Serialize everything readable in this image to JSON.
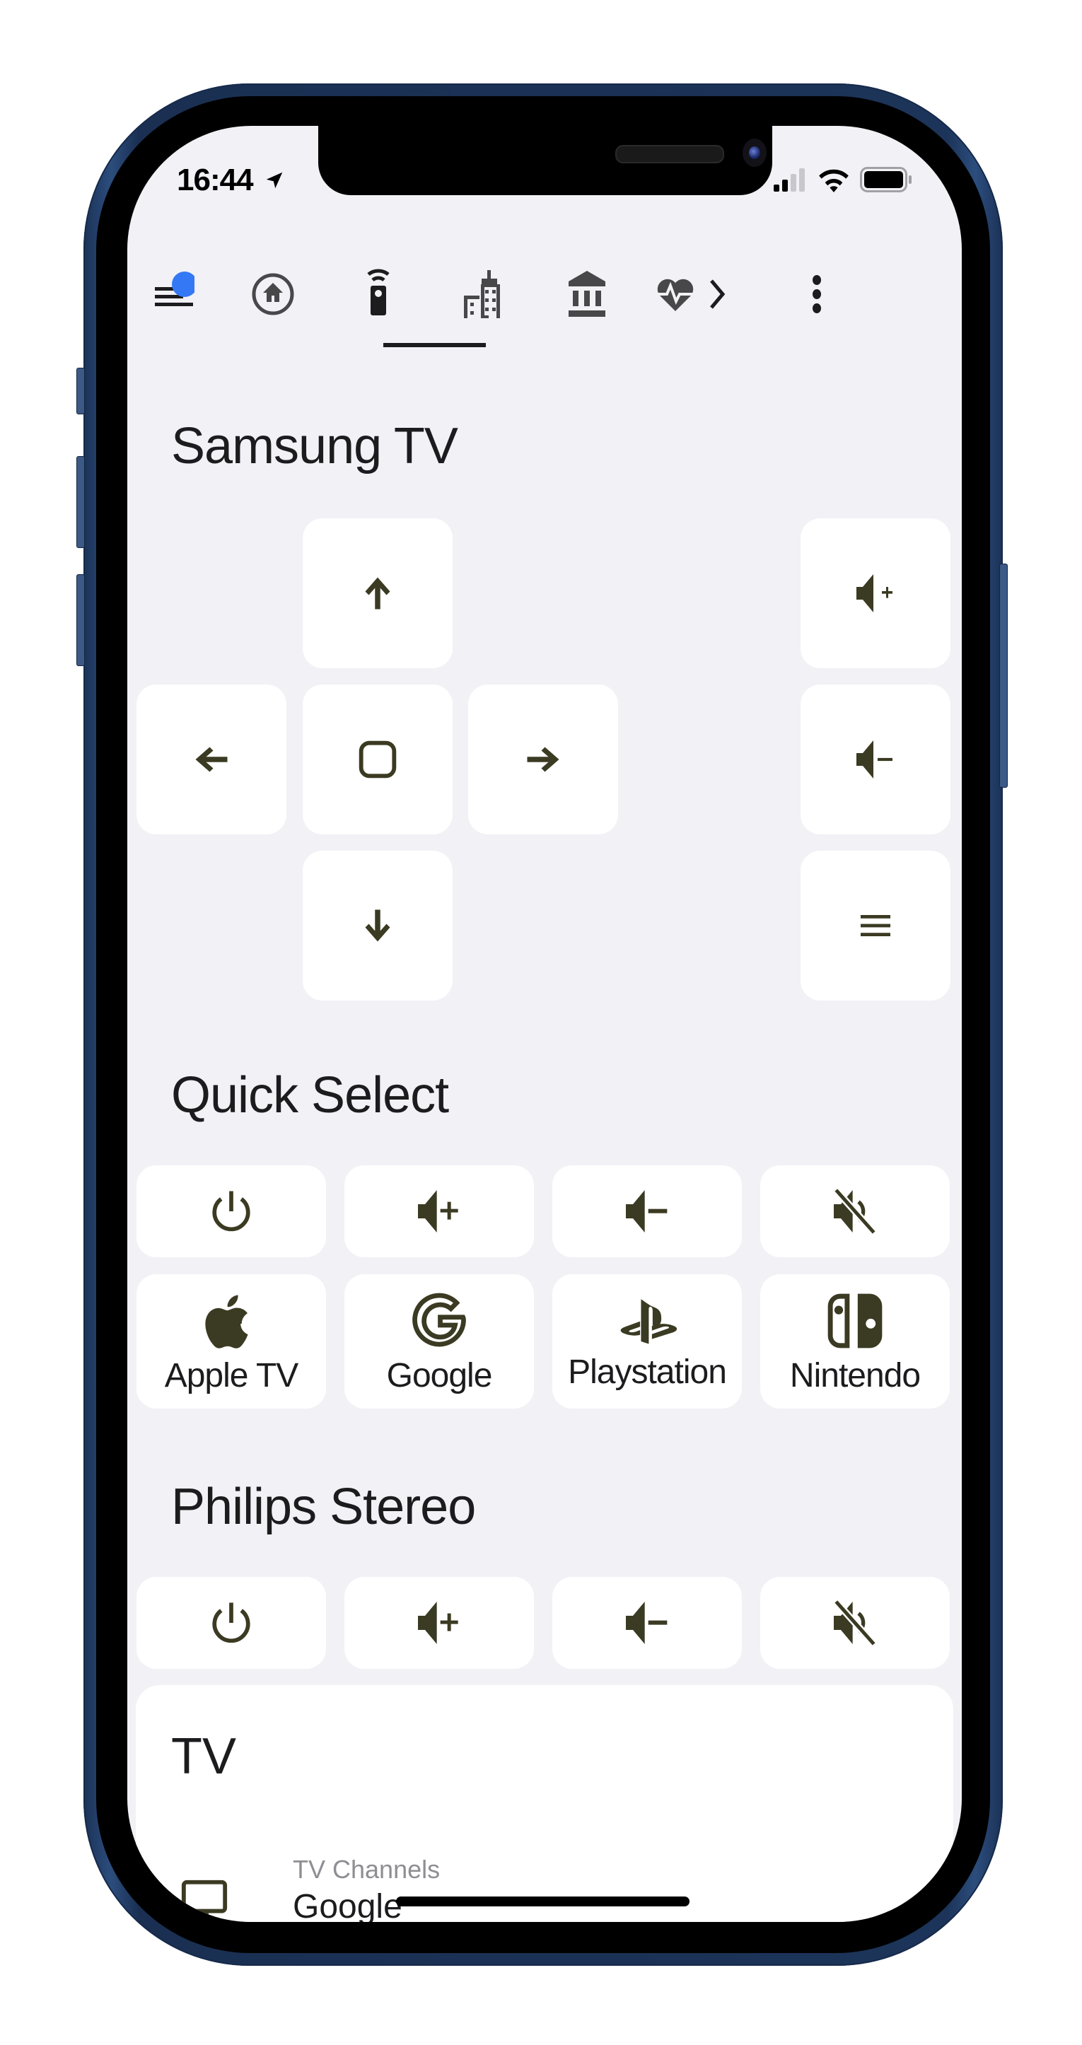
{
  "status_bar": {
    "time": "16:44",
    "location_icon": "location-arrow-icon",
    "signal_icon": "cellular-signal-icon",
    "wifi_icon": "wifi-icon",
    "battery_icon": "battery-icon"
  },
  "tabs": [
    {
      "name": "menu",
      "icon": "menu-icon",
      "has_badge": true,
      "badge_color": "#3478f6"
    },
    {
      "name": "home",
      "icon": "home-circle-icon"
    },
    {
      "name": "remote",
      "icon": "remote-icon",
      "active": true
    },
    {
      "name": "city",
      "icon": "city-icon"
    },
    {
      "name": "bank",
      "icon": "bank-icon"
    },
    {
      "name": "health",
      "icon": "heart-pulse-icon"
    },
    {
      "name": "more-tabs",
      "icon": "chevron-right-icon"
    },
    {
      "name": "overflow",
      "icon": "more-vertical-icon"
    }
  ],
  "samsung": {
    "title": "Samsung TV",
    "buttons": [
      "up",
      "left",
      "select",
      "right",
      "down",
      "volume-up",
      "volume-down",
      "menu"
    ]
  },
  "quick_select": {
    "title": "Quick Select",
    "controls": [
      "power",
      "volume-up",
      "volume-down",
      "mute"
    ],
    "sources": [
      {
        "label": "Apple TV",
        "icon": "apple-icon"
      },
      {
        "label": "Google",
        "icon": "google-icon"
      },
      {
        "label": "Playstation",
        "icon": "playstation-icon"
      },
      {
        "label": "Nintendo",
        "icon": "nintendo-switch-icon"
      }
    ]
  },
  "philips": {
    "title": "Philips Stereo",
    "controls": [
      "power",
      "volume-up",
      "volume-down",
      "mute"
    ]
  },
  "tv_card": {
    "title": "TV",
    "row": {
      "secondary": "TV Channels",
      "primary": "Google",
      "icon": "television-icon"
    }
  },
  "colors": {
    "screen_bg": "#f1f1f6",
    "icon_fg": "#3b3a22",
    "badge": "#3478f6",
    "frame": "#1f3a64"
  }
}
